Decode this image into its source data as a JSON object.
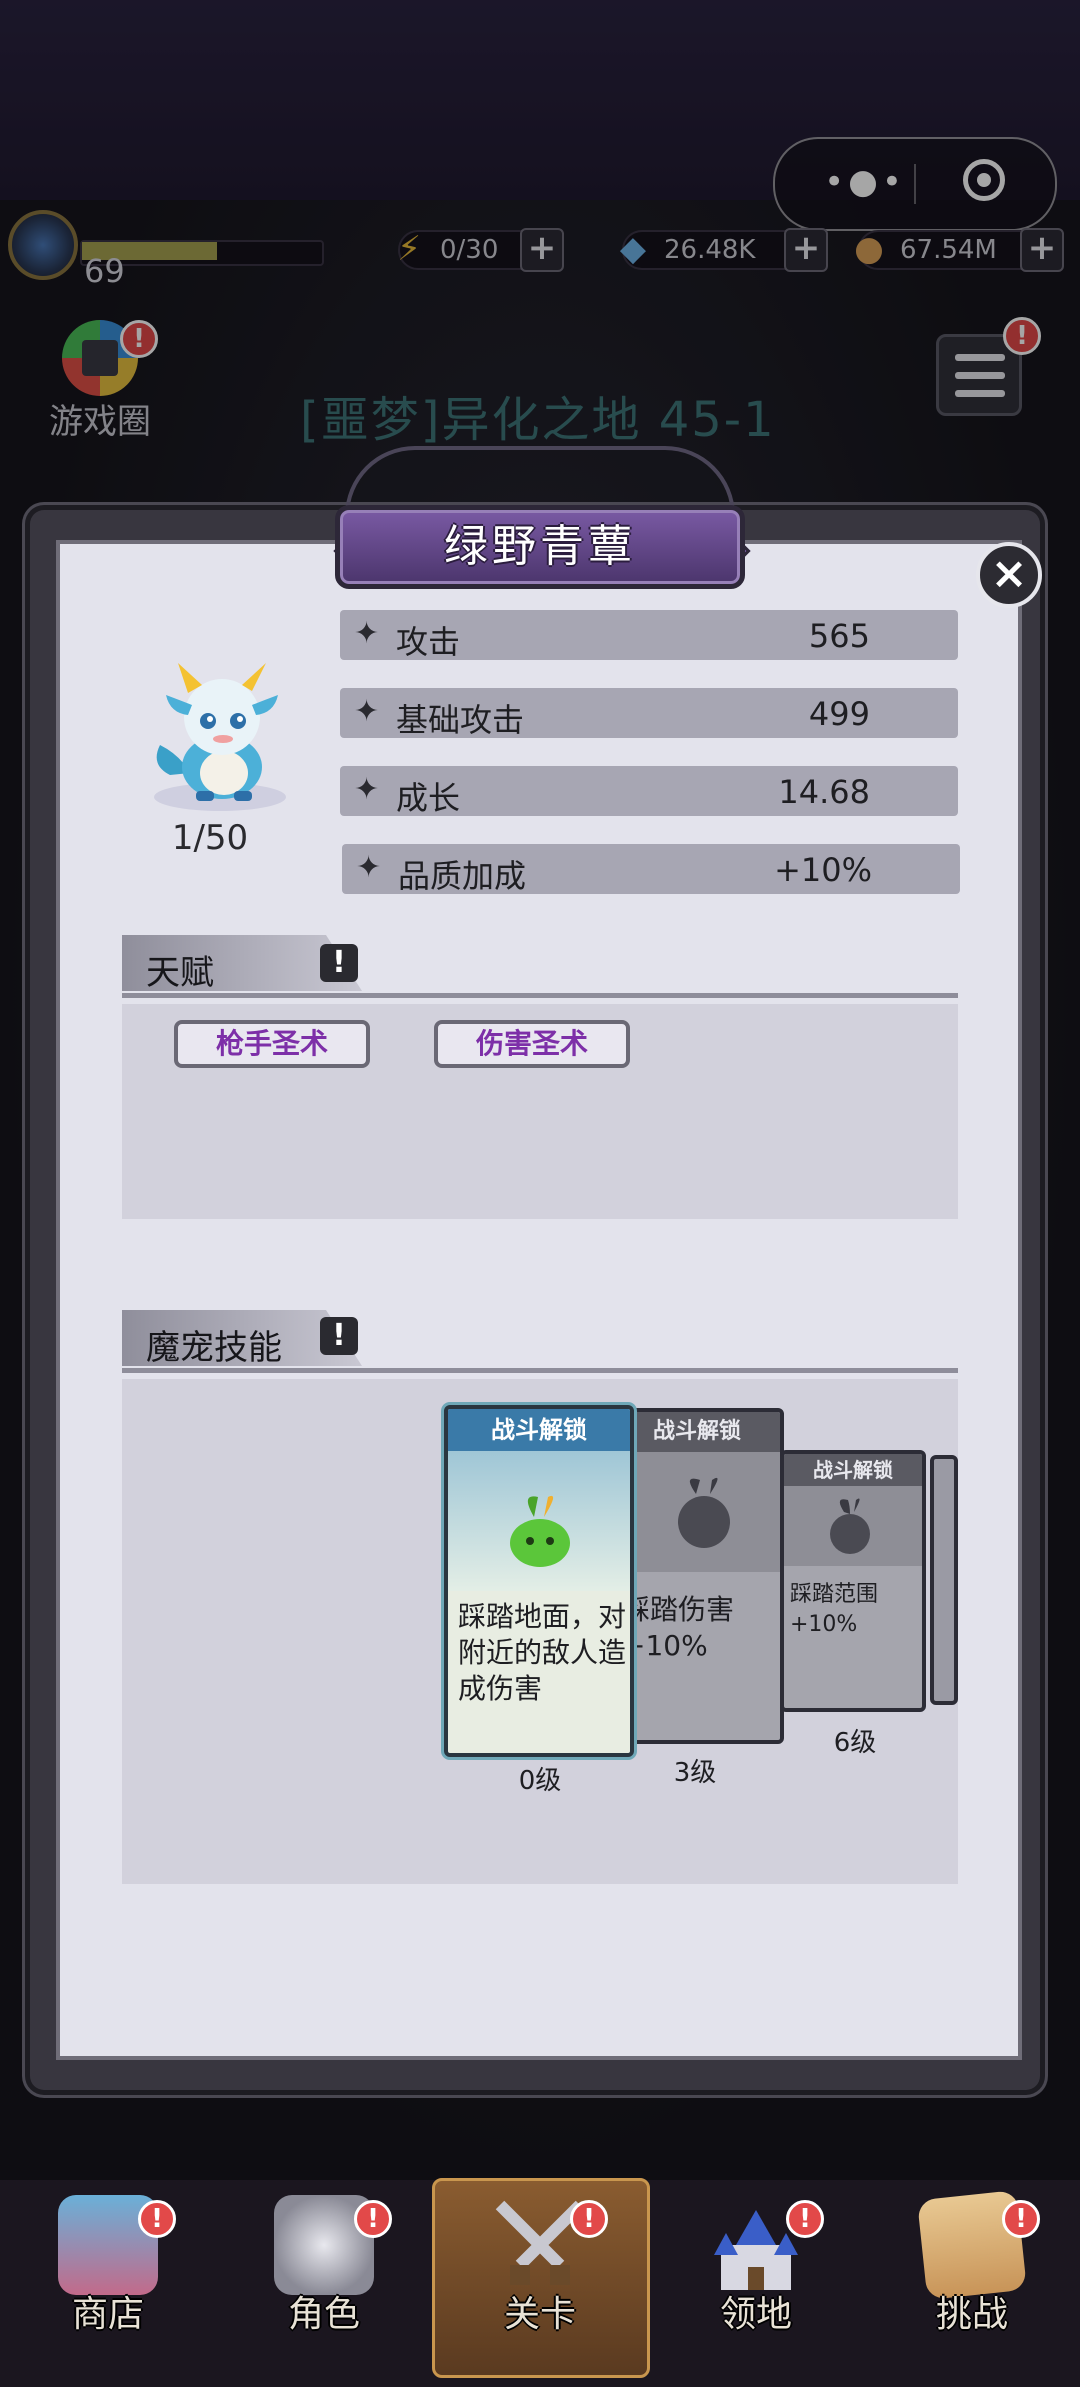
{
  "capsule": {
    "more_icon": "more-dots-icon",
    "close_icon": "target-icon"
  },
  "resources": {
    "level": "69",
    "energy": "0/30",
    "gems": "26.48K",
    "gold": "67.54M"
  },
  "header": {
    "game_circle_label": "游戏圈",
    "stage_title": "[噩梦]异化之地 45-1"
  },
  "modal": {
    "title": "绿野青蕈",
    "pet_level": "1/50",
    "stats": [
      {
        "label": "攻击",
        "value": "565"
      },
      {
        "label": "基础攻击",
        "value": "499"
      },
      {
        "label": "成长",
        "value": "14.68"
      },
      {
        "label": "品质加成",
        "value": "+10%"
      }
    ],
    "talent_header": "天赋",
    "talents": [
      "枪手圣术",
      "伤害圣术"
    ],
    "skills_header": "魔宠技能",
    "skills": [
      {
        "header": "战斗解锁",
        "desc": "踩踏地面，对附近的敌人造成伤害",
        "level": "0级",
        "locked": false
      },
      {
        "header": "战斗解锁",
        "desc": "踩踏伤害+10%",
        "level": "3级",
        "locked": true
      },
      {
        "header": "战斗解锁",
        "desc": "踩踏范围+10%",
        "level": "6级",
        "locked": true
      }
    ]
  },
  "nav": [
    {
      "label": "商店",
      "icon": "shop-icon",
      "badge": "!"
    },
    {
      "label": "角色",
      "icon": "character-icon",
      "badge": "!"
    },
    {
      "label": "关卡",
      "icon": "crossed-swords-icon",
      "badge": "!"
    },
    {
      "label": "领地",
      "icon": "castle-icon",
      "badge": "!"
    },
    {
      "label": "挑战",
      "icon": "challenge-map-icon",
      "badge": "!"
    }
  ],
  "colors": {
    "accent_purple": "#7a5aa4",
    "talent_text": "#7d2fa8",
    "badge_red": "#e24949"
  }
}
